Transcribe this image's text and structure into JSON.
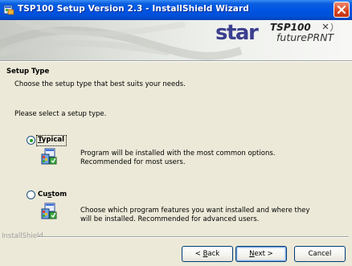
{
  "window": {
    "title": "TSP100 Setup Version 2.3 - InstallShield Wizard",
    "icon": "setup-window-icon",
    "close_icon": "close-icon"
  },
  "banner": {
    "brand_logo": "star",
    "product_logo_line1": "TSP100",
    "product_logo_line2": "futurePRNT"
  },
  "page": {
    "heading": "Setup Type",
    "subheading": "Choose the setup type that best suits your needs.",
    "instruction": "Please select a setup type."
  },
  "options": [
    {
      "label_prefix": "",
      "label_hotkey": "T",
      "label_rest": "ypical",
      "selected": true,
      "description_line1": "Program will be installed with the most common options.",
      "description_line2": "Recommended for most users."
    },
    {
      "label_prefix": "Cu",
      "label_hotkey": "s",
      "label_rest": "tom",
      "selected": false,
      "description_line1": "Choose which program features you want installed and where they",
      "description_line2": "will be installed. Recommended for advanced users."
    }
  ],
  "footer": {
    "brand": "InstallShield",
    "back_prefix": "< ",
    "back_hotkey": "B",
    "back_rest": "ack",
    "next_hotkey": "N",
    "next_rest": "ext >",
    "cancel_label": "Cancel"
  },
  "colors": {
    "titlebar": "#0054e3",
    "close_button": "#d9421e",
    "dialog_bg": "#ece9d8",
    "radio_dot": "#21a121",
    "star_logo": "#3b3f8f"
  }
}
